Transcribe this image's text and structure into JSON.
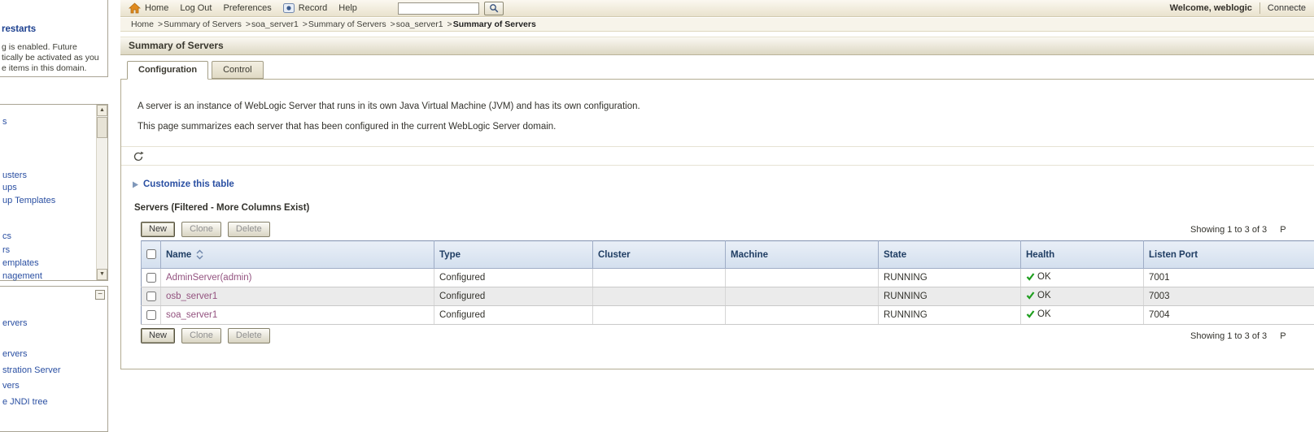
{
  "banner": {
    "links": {
      "home": "Home",
      "logout": "Log Out",
      "preferences": "Preferences",
      "record": "Record",
      "help": "Help"
    },
    "search_value": "",
    "welcome": "Welcome, weblogic",
    "connected": "Connecte"
  },
  "breadcrumb": {
    "sep": ">",
    "items": [
      "Home",
      "Summary of Servers",
      "soa_server1",
      "Summary of Servers",
      "soa_server1"
    ],
    "current": "Summary of Servers"
  },
  "page": {
    "title": "Summary of Servers",
    "tabs": {
      "configuration": "Configuration",
      "control": "Control"
    },
    "intro1": "A server is an instance of WebLogic Server that runs in its own Java Virtual Machine (JVM) and has its own configuration.",
    "intro2": "This page summarizes each server that has been configured in the current WebLogic Server domain.",
    "customize": "Customize this table",
    "table_title": "Servers (Filtered - More Columns Exist)",
    "buttons": {
      "new": "New",
      "clone": "Clone",
      "delete": "Delete"
    },
    "paging": {
      "showing": "Showing 1 to 3 of 3",
      "prev": "P"
    }
  },
  "table": {
    "columns": [
      "Name",
      "Type",
      "Cluster",
      "Machine",
      "State",
      "Health",
      "Listen Port"
    ],
    "rows": [
      {
        "name": "AdminServer(admin)",
        "type": "Configured",
        "cluster": "",
        "machine": "",
        "state": "RUNNING",
        "health": "OK",
        "port": "7001"
      },
      {
        "name": "osb_server1",
        "type": "Configured",
        "cluster": "",
        "machine": "",
        "state": "RUNNING",
        "health": "OK",
        "port": "7003"
      },
      {
        "name": "soa_server1",
        "type": "Configured",
        "cluster": "",
        "machine": "",
        "state": "RUNNING",
        "health": "OK",
        "port": "7004"
      }
    ]
  },
  "sidebar": {
    "change_center": {
      "heading": "restarts",
      "line1": "g is enabled. Future",
      "line2": "tically be activated as you",
      "line3": "e items in this domain."
    },
    "tree": [
      "s",
      "usters",
      "ups",
      "up Templates",
      "cs",
      "rs",
      "emplates",
      "nagement"
    ],
    "howdoi": [
      "ervers",
      "ervers",
      "stration Server",
      "vers",
      "e JNDI tree"
    ],
    "scroll_up": "▲",
    "scroll_down": "▼",
    "collapse": "−"
  },
  "colors": {
    "accent_blue": "#2a4fa2",
    "table_header_text": "#1f3d63",
    "ok_green": "#1e9e1e",
    "name_link": "#93527f",
    "banner_beige": "#e9e2cd"
  }
}
